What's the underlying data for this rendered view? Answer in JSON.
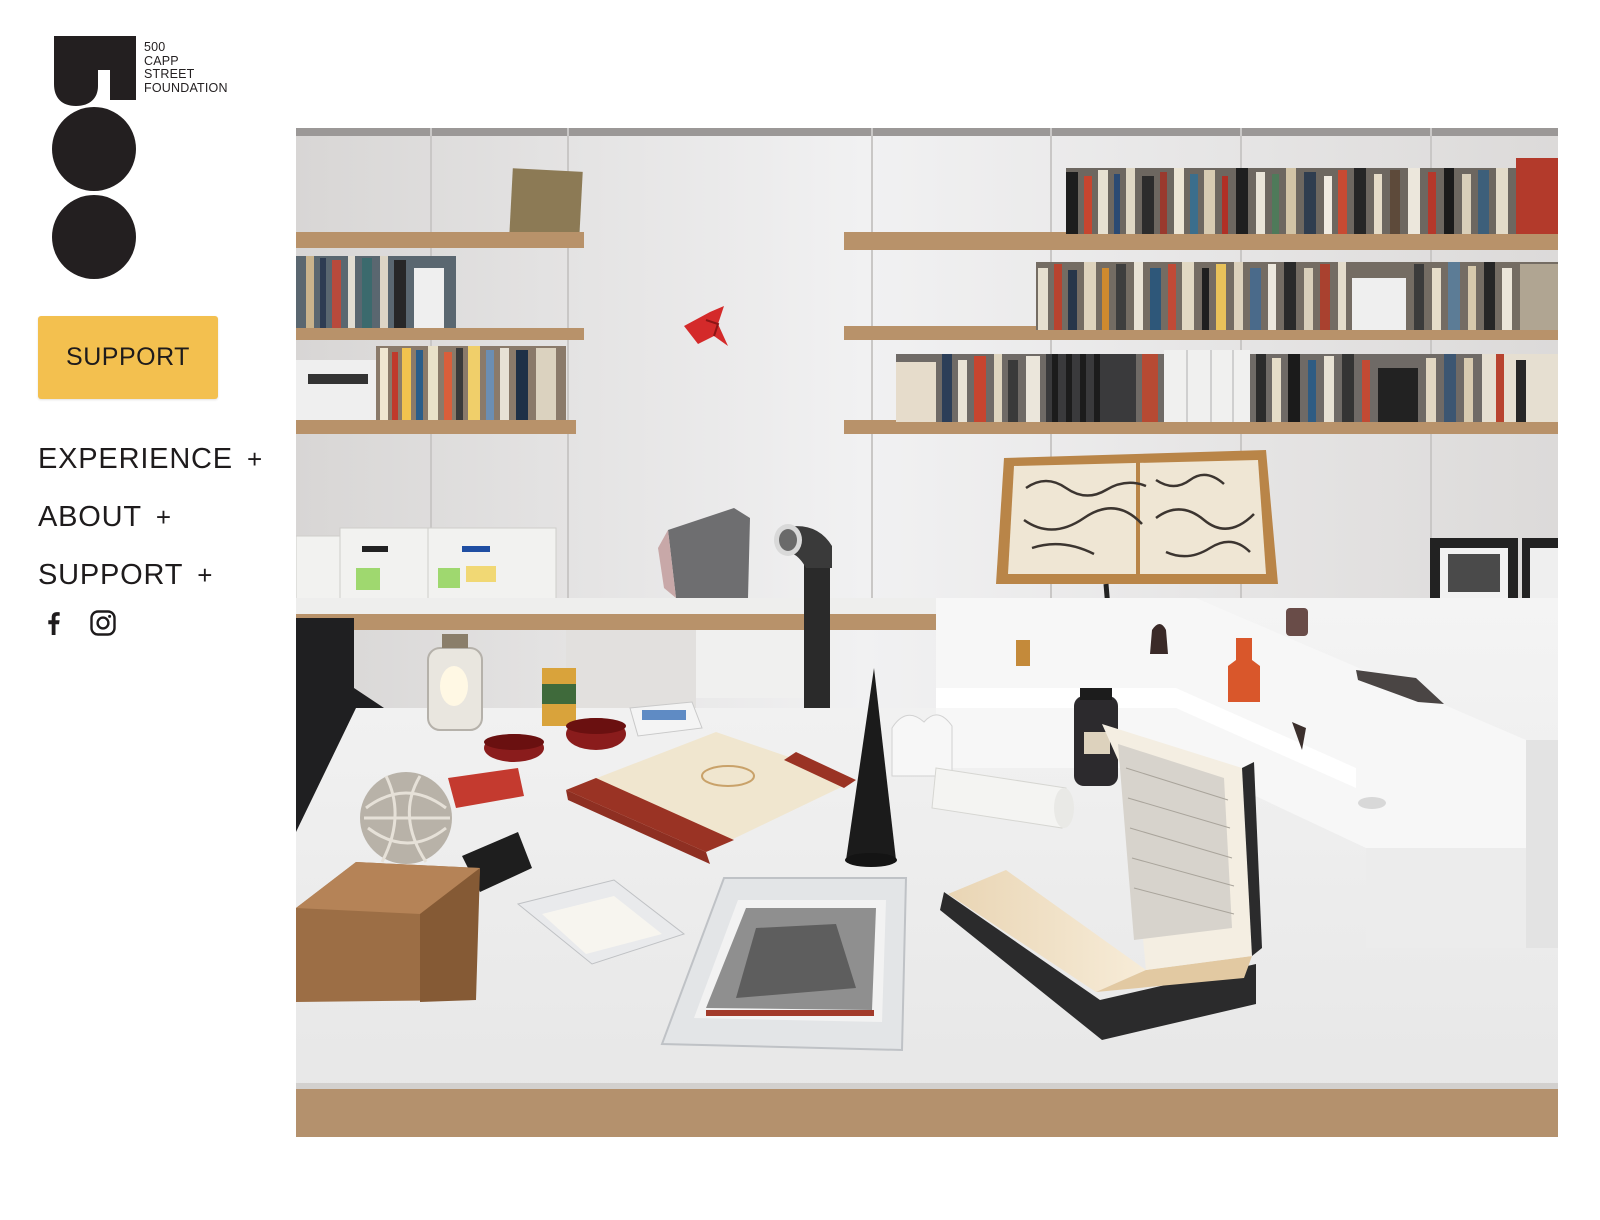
{
  "brand": {
    "logo_lines": [
      "500",
      "CAPP",
      "STREET",
      "FOUNDATION"
    ],
    "accent_color": "#f3c04f",
    "text_color": "#1e1b1c"
  },
  "sidebar": {
    "support_button": "SUPPORT",
    "nav": [
      {
        "label": "EXPERIENCE",
        "toggle": "+"
      },
      {
        "label": "ABOUT",
        "toggle": "+"
      },
      {
        "label": "SUPPORT",
        "toggle": "+"
      }
    ],
    "social": [
      {
        "icon": "facebook-icon"
      },
      {
        "icon": "instagram-icon"
      }
    ]
  },
  "hero": {
    "subject": "Archive room with bookshelves and a white display table of objects, books and photographs"
  }
}
